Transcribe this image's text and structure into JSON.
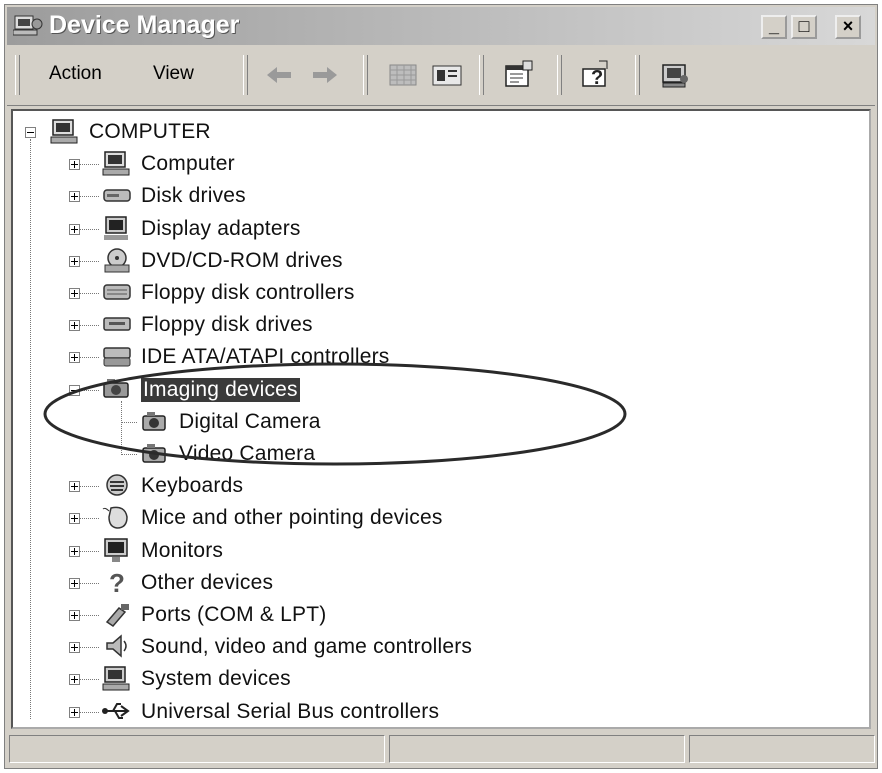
{
  "window": {
    "title": "Device Manager",
    "minimize": "_",
    "maximize": "□",
    "close": "×"
  },
  "menu": {
    "action": "Action",
    "view": "View"
  },
  "toolbar_icons": [
    "back-arrow-icon",
    "forward-arrow-icon",
    "properties-grid-icon",
    "console-tree-icon",
    "properties-icon",
    "help-icon",
    "scan-hardware-icon"
  ],
  "tree": {
    "root": "COMPUTER",
    "items": [
      "Computer",
      "Disk drives",
      "Display adapters",
      "DVD/CD-ROM drives",
      "Floppy disk controllers",
      "Floppy disk drives",
      "IDE ATA/ATAPI controllers",
      "Imaging devices",
      "Keyboards",
      "Mice and other pointing devices",
      "Monitors",
      "Other devices",
      "Ports (COM & LPT)",
      "Sound, video and game controllers",
      "System devices",
      "Universal Serial Bus controllers"
    ],
    "imaging_children": [
      "Digital Camera",
      "Video Camera"
    ]
  },
  "status": {
    "pane1": "",
    "pane2": "",
    "pane3": ""
  }
}
